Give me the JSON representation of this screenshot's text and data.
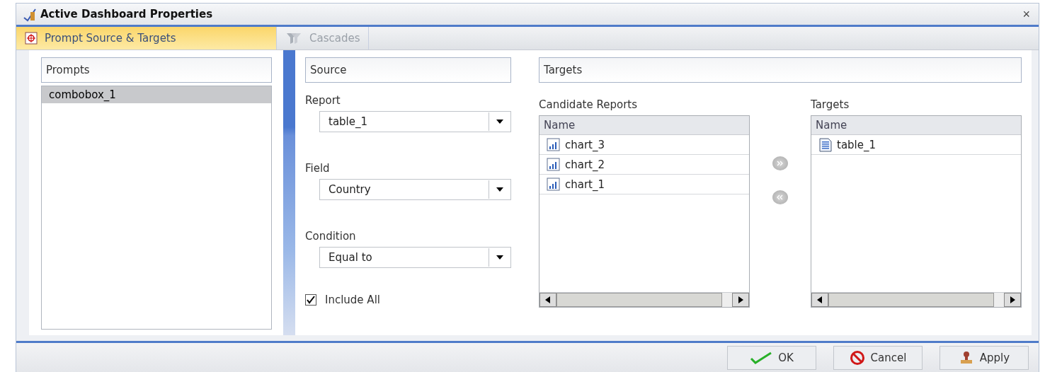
{
  "window": {
    "title": "Active Dashboard Properties",
    "close": "×"
  },
  "tabs": [
    {
      "label": "Prompt Source & Targets",
      "selected": true
    },
    {
      "label": "Cascades",
      "selected": false
    }
  ],
  "prompts": {
    "header": "Prompts",
    "items": [
      {
        "label": "combobox_1",
        "selected": true
      }
    ]
  },
  "source": {
    "header": "Source",
    "fields": [
      {
        "label": "Report",
        "value": "table_1"
      },
      {
        "label": "Field",
        "value": "Country"
      },
      {
        "label": "Condition",
        "value": "Equal to"
      }
    ],
    "include_all": {
      "label": "Include All",
      "checked": true
    }
  },
  "targets": {
    "header": "Targets",
    "candidate": {
      "title": "Candidate Reports",
      "column": "Name",
      "items": [
        {
          "label": "chart_3",
          "kind": "chart"
        },
        {
          "label": "chart_2",
          "kind": "chart"
        },
        {
          "label": "chart_1",
          "kind": "chart"
        }
      ]
    },
    "selected": {
      "title": "Targets",
      "column": "Name",
      "items": [
        {
          "label": "table_1",
          "kind": "table"
        }
      ]
    }
  },
  "buttons": [
    {
      "label": "OK",
      "kind": "ok"
    },
    {
      "label": "Cancel",
      "kind": "cancel"
    },
    {
      "label": "Apply",
      "kind": "apply"
    }
  ]
}
